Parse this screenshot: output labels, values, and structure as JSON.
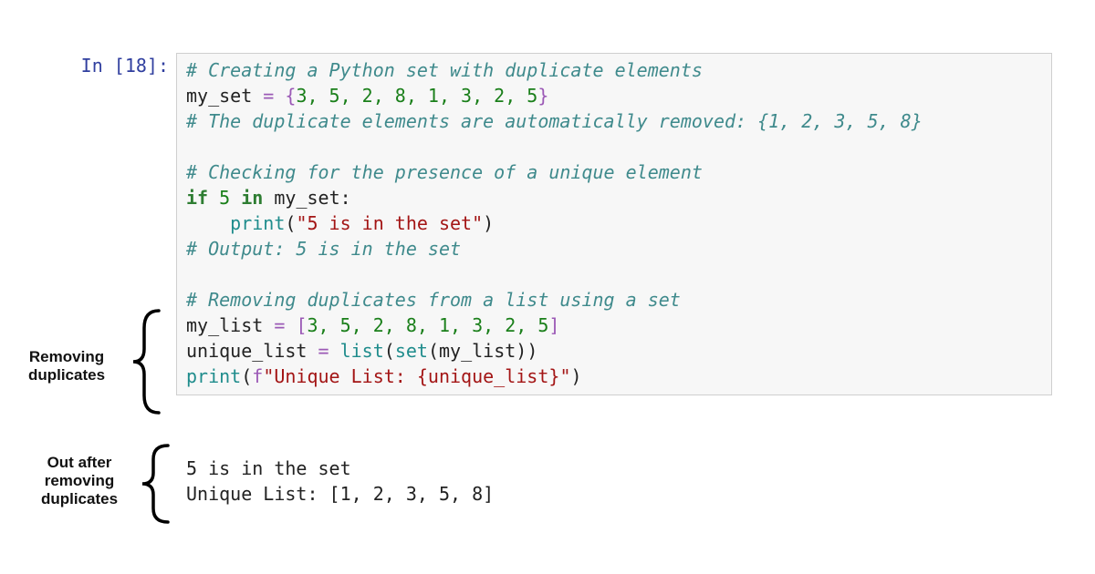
{
  "prompt": {
    "text": "In [18]:"
  },
  "code": {
    "comment1": "# Creating a Python set with duplicate elements",
    "assign1_lhs": "my_set",
    "assign1_nums": "3, 5, 2, 8, 1, 3, 2, 5",
    "comment2": "# The duplicate elements are automatically removed: {1, 2, 3, 5, 8}",
    "comment3": "# Checking for the presence of a unique element",
    "if_kw": "if",
    "if_test_num": "5",
    "in_kw": "in",
    "if_target": "my_set",
    "print1_fn": "print",
    "print1_str": "\"5 is in the set\"",
    "comment4": "# Output: 5 is in the set",
    "comment5": "# Removing duplicates from a list using a set",
    "assign2_lhs": "my_list",
    "assign2_nums": "3, 5, 2, 8, 1, 3, 2, 5",
    "assign3_lhs": "unique_list",
    "list_fn": "list",
    "set_fn": "set",
    "inner_name": "my_list",
    "print2_fn": "print",
    "fprefix": "f",
    "print2_str_a": "\"Unique List: ",
    "print2_interp": "{unique_list}",
    "print2_str_b": "\""
  },
  "output": {
    "line1": "5 is in the set",
    "line2": "Unique List: [1, 2, 3, 5, 8]"
  },
  "annotations": {
    "a1_line1": "Removing",
    "a1_line2": "duplicates",
    "a2_line1": "Out after",
    "a2_line2": "removing",
    "a2_line3": "duplicates"
  }
}
